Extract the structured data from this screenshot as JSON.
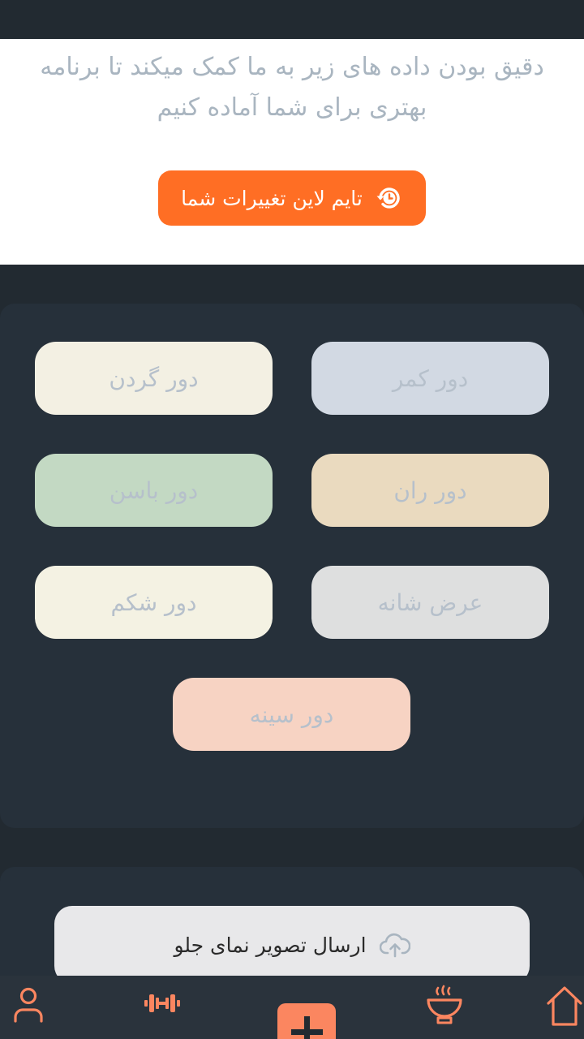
{
  "info": {
    "line1": "دقیق بودن داده های زیر به ما کمک میکند تا برنامه",
    "line2": "بهتری برای شما آماده کنیم",
    "timeline_button": "تایم لاین تغییرات شما"
  },
  "measurements": [
    {
      "label": "دور کمر",
      "color": "#d2d9e3"
    },
    {
      "label": "دور گردن",
      "color": "#f3f0e3"
    },
    {
      "label": "دور ران",
      "color": "#eadabf"
    },
    {
      "label": "دور باسن",
      "color": "#c3d9c3"
    },
    {
      "label": "عرض شانه",
      "color": "#dedfdf"
    },
    {
      "label": "دور شکم",
      "color": "#f4f2e3"
    },
    {
      "label": "دور سینه",
      "color": "#f7d3c3"
    }
  ],
  "upload": {
    "label": "ارسال تصویر نمای جلو",
    "icon": "cloud-upload-icon"
  },
  "nav": {
    "items": [
      "profile-icon",
      "dumbbell-icon",
      "add-icon",
      "bowl-icon",
      "home-icon"
    ],
    "accent": "#fb8660"
  },
  "colors": {
    "accent_orange": "#ff6e24",
    "background": "#222a31"
  }
}
